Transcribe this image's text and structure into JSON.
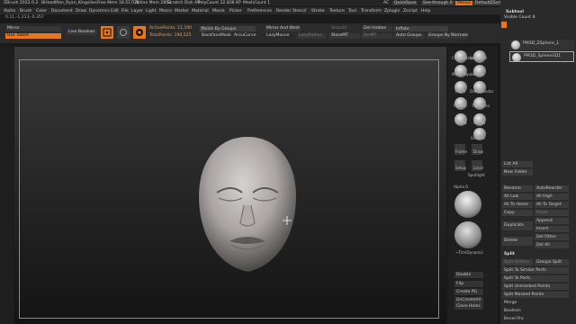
{
  "titlebar": {
    "items": [
      "ZBrush 2022.0.2",
      "BHeadMan_Ryan_Kingslien",
      "Free Mem 18.517GB",
      "Active Mem 2852",
      "Scratch Disk 49",
      "PolyCount 32.836 KP",
      "MeshCount 1"
    ],
    "ac": "AC",
    "quicksave": "QuickSave",
    "seethrough": "See-through  0",
    "menus_btn": "Menus",
    "script": "DefaultZScript"
  },
  "menubar": [
    "Alpha",
    "Brush",
    "Color",
    "Document",
    "Draw",
    "Dynamics",
    "Edit",
    "File",
    "Layer",
    "Light",
    "Macro",
    "Marker",
    "Material",
    "Movie",
    "Picker",
    "Preferences",
    "Render",
    "Stencil",
    "Stroke",
    "Texture",
    "Tool",
    "Transform",
    "Zplugin",
    "Zscript",
    "Help"
  ],
  "coords": "0.11,-1.213,-0.357",
  "toolbar": {
    "mirror": "Mirror",
    "use_tablet": "Use Tablet",
    "live_boolean": "Live Boolean",
    "draw": "Draw",
    "solo": "Solo",
    "active_points": "ActivePoints: 21,190",
    "total_points": "TotalPoints: 190,525",
    "polish_by_groups": "Polish By Groups",
    "backface_mask": "BackfaceMask",
    "accu_curve": "AccuCurve",
    "mirror_and_weld": "Mirror And Weld",
    "lazy_mouse": "LazyMouse",
    "lazy_radius": "LazyRadius",
    "smooth": "Smooth",
    "store_mt": "StoreMT",
    "del_hidden": "Del Hidden",
    "del_mt": "DelMT",
    "inflate": "Inflate",
    "auto_groups": "Auto Groups",
    "groups_by_normals": "Groups By Normals"
  },
  "shelf": {
    "brushes": [
      {
        "label": "ClayBuildup"
      },
      {
        "label": "Standard"
      },
      {
        "label": "Move Topolo"
      },
      {
        "label": "Move"
      },
      {
        "label": "Pinch"
      },
      {
        "label": "DamStandar"
      },
      {
        "label": "hPolish"
      },
      {
        "label": "TrimDyna"
      },
      {
        "label": "Inflat"
      },
      {
        "label": "Morph"
      },
      {
        "label": "SnakeH"
      },
      {
        "label": "Frame"
      },
      {
        "label": "Draw"
      },
      {
        "label": "Setup"
      },
      {
        "label": "Local"
      },
      {
        "label": "Spotlight"
      }
    ],
    "alpha_label": "Alpha 0",
    "trim_label": "~TrimDynamic",
    "actions": [
      "Double",
      "Flip",
      "Create PG",
      "UnCreateAll",
      "Close Holes"
    ]
  },
  "palette": {
    "subtool_title": "Subtool",
    "visible_count": "Visible Count 8",
    "subtools": [
      {
        "name": "PM3D_ZSphere_1"
      },
      {
        "name": "PM3D_Sphere3D1"
      }
    ],
    "list_all": "List All",
    "new_folder": "New Folder",
    "rename": "Rename",
    "auto_reorder": "AutoReorder",
    "all_low": "All Low",
    "all_high": "All High",
    "all_to_home": "All To Home",
    "all_to_target": "All To Target",
    "copy": "Copy",
    "paste": "Paste",
    "duplicate": "Duplicate",
    "append": "Append",
    "insert": "Insert",
    "delete": "Delete",
    "del_other": "Del Other",
    "del_all": "Del All",
    "split_title": "Split",
    "split_hidden": "Split Hidden",
    "groups_split": "Groups Split",
    "split_to_similar": "Split To Similar Parts",
    "split_to_parts": "Split To Parts",
    "split_unmasked": "Split Unmasked Points",
    "split_masked": "Split Masked Points",
    "merge": "Merge",
    "boolean": "Boolean",
    "bevel_pro": "Bevel Pro"
  },
  "colors": {
    "accent": "#e8761f",
    "bg": "#1a1a1a"
  }
}
